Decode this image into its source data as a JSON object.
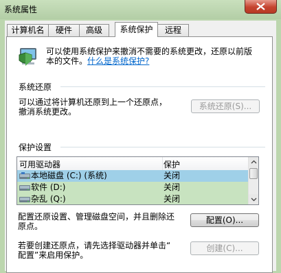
{
  "window": {
    "title": "系统属性"
  },
  "tabs": [
    {
      "label": "计算机名"
    },
    {
      "label": "硬件"
    },
    {
      "label": "高级"
    },
    {
      "label": "系统保护"
    },
    {
      "label": "远程"
    }
  ],
  "intro": {
    "line1": "可以使用系统保护来撤消不需要的系统更改，还原以前版",
    "line2_prefix": "本的文件。",
    "link": "什么是系统保护?"
  },
  "restore": {
    "title": "系统还原",
    "desc_line1": "可以通过将计算机还原到上一个还原点，",
    "desc_line2": "撤消系统更改。",
    "button": "系统还原(S)..."
  },
  "protection": {
    "title": "保护设置",
    "columns": [
      "可用驱动器",
      "保护"
    ],
    "rows": [
      {
        "drive": "本地磁盘 (C:) (系统)",
        "status": "关闭"
      },
      {
        "drive": "软件 (D:)",
        "status": "关闭"
      },
      {
        "drive": "杂乱 (Q:)",
        "status": "关闭"
      }
    ],
    "configure_desc_line1": "配置还原设置、管理磁盘空间，并且删除还",
    "configure_desc_line2": "原点。",
    "configure_button": "配置(O)...",
    "create_desc_line1": "若要创建还原点，请先选择驱动器并单击“",
    "create_desc_line2": "配置”来启用保护。",
    "create_button": "创建(C)..."
  },
  "colors": {
    "background": "#bcd6ae",
    "selection": "#9fd0e8",
    "row_highlight": "#c8e3c0",
    "link": "#0066cc",
    "close_button": "#c5432f"
  }
}
